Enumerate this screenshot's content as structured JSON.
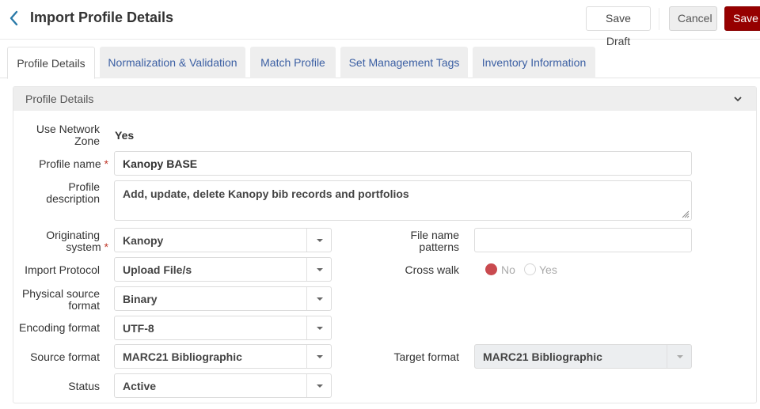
{
  "header": {
    "title": "Import Profile Details",
    "back_icon": "chevron-left-icon",
    "buttons": {
      "save_draft": "Save Draft",
      "cancel": "Cancel",
      "save": "Save"
    }
  },
  "tabs": [
    {
      "label": "Profile Details",
      "active": true
    },
    {
      "label": "Normalization & Validation",
      "active": false
    },
    {
      "label": "Match Profile",
      "active": false
    },
    {
      "label": "Set Management Tags",
      "active": false
    },
    {
      "label": "Inventory Information",
      "active": false
    }
  ],
  "panel": {
    "title": "Profile Details",
    "collapse_icon": "chevron-down-icon",
    "fields": {
      "use_network_zone": {
        "label_1": "Use Network",
        "label_2": "Zone",
        "value": "Yes"
      },
      "profile_name": {
        "label": "Profile name",
        "required": "*",
        "value": "Kanopy BASE"
      },
      "profile_description": {
        "label_1": "Profile",
        "label_2": "description",
        "value": "Add, update, delete Kanopy bib records and portfolios"
      },
      "originating_system": {
        "label_1": "Originating",
        "label_2": "system",
        "required": "*",
        "value": "Kanopy"
      },
      "import_protocol": {
        "label": "Import Protocol",
        "value": "Upload File/s"
      },
      "physical_source_format": {
        "label_1": "Physical source",
        "label_2": "format",
        "value": "Binary"
      },
      "encoding_format": {
        "label": "Encoding format",
        "value": "UTF-8"
      },
      "source_format": {
        "label": "Source format",
        "value": "MARC21 Bibliographic"
      },
      "status": {
        "label": "Status",
        "value": "Active"
      },
      "file_name_patterns": {
        "label_1": "File name",
        "label_2": "patterns",
        "value": ""
      },
      "cross_walk": {
        "label": "Cross walk",
        "options": [
          "No",
          "Yes"
        ],
        "selected": "No"
      },
      "target_format": {
        "label": "Target format",
        "value": "MARC21 Bibliographic",
        "disabled": true
      }
    }
  },
  "colors": {
    "save_button": "#960000",
    "tab_link": "#3b5fa3",
    "back_icon": "#2a7aa8",
    "radio_selected": "#c94a4f",
    "required_marker": "#c0392b"
  }
}
